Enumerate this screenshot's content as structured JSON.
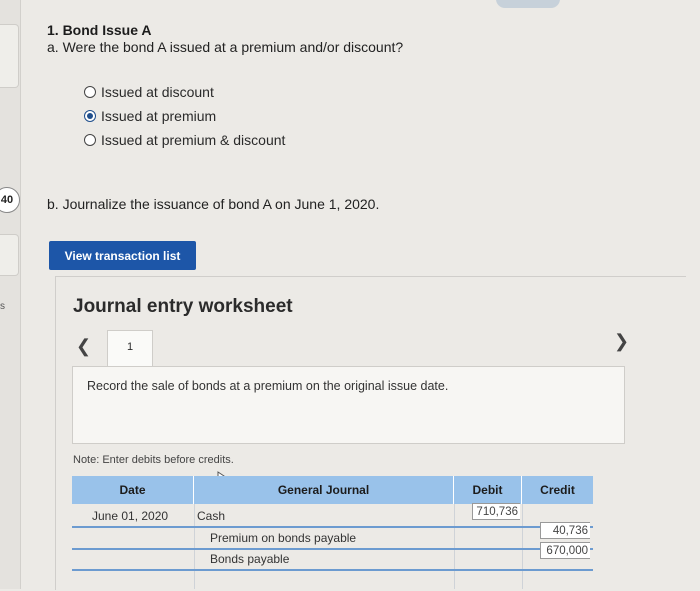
{
  "sidebar": {
    "badge": "40",
    "tag": "s"
  },
  "question": {
    "title": "1. Bond Issue A",
    "part_a": "a. Were the bond A issued at a premium and/or discount?",
    "options": [
      "Issued at discount",
      "Issued at premium",
      "Issued at premium & discount"
    ],
    "selected": "Issued at premium",
    "part_b": "b. Journalize the issuance of bond A on June 1, 2020."
  },
  "view_button": "View transaction list",
  "worksheet": {
    "title": "Journal entry worksheet",
    "tab": "1",
    "instruction": "Record the sale of bonds at a premium on the original issue date.",
    "note": "Note: Enter debits before credits."
  },
  "journal": {
    "headers": {
      "date": "Date",
      "account": "General Journal",
      "debit": "Debit",
      "credit": "Credit"
    },
    "rows": [
      {
        "date": "June 01, 2020",
        "account": "Cash",
        "debit": "710,736",
        "credit": ""
      },
      {
        "date": "",
        "account": "Premium on bonds payable",
        "debit": "",
        "credit": "40,736"
      },
      {
        "date": "",
        "account": "Bonds payable",
        "debit": "",
        "credit": "670,000"
      }
    ]
  }
}
